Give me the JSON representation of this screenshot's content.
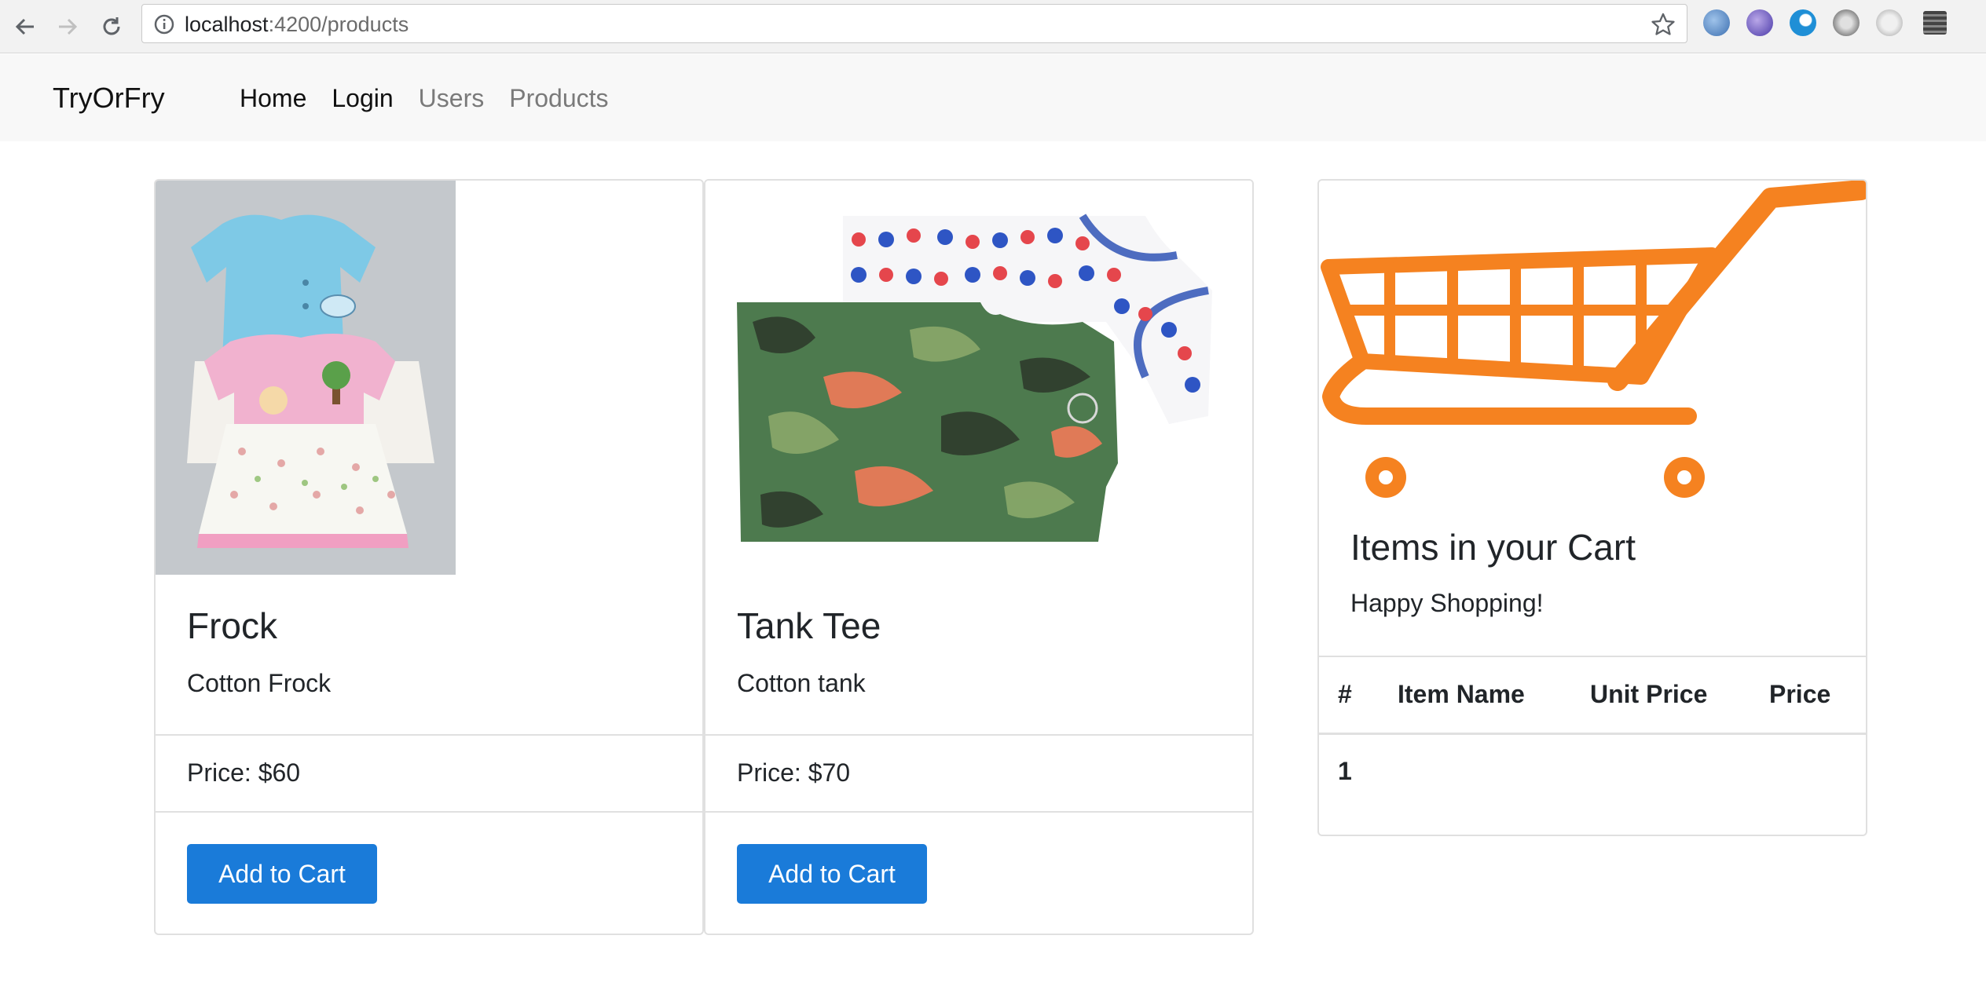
{
  "browser": {
    "url_host": "localhost",
    "url_rest": ":4200/products"
  },
  "navbar": {
    "brand": "TryOrFry",
    "links": [
      {
        "label": "Home"
      },
      {
        "label": "Login"
      },
      {
        "label": "Users"
      },
      {
        "label": "Products"
      }
    ]
  },
  "products": [
    {
      "title": "Frock",
      "description": "Cotton Frock",
      "price": "Price: $60",
      "button": "Add to Cart"
    },
    {
      "title": "Tank Tee",
      "description": "Cotton tank",
      "price": "Price: $70",
      "button": "Add to Cart"
    }
  ],
  "cart": {
    "title": "Items in your Cart",
    "subtitle": "Happy Shopping!",
    "columns": [
      "#",
      "Item Name",
      "Unit Price",
      "Price"
    ],
    "rows": [
      {
        "index": "1"
      }
    ],
    "accent_color": "#f58220"
  },
  "colors": {
    "button": "#1a7bd9",
    "navbar_bg": "#f8f8f8"
  }
}
